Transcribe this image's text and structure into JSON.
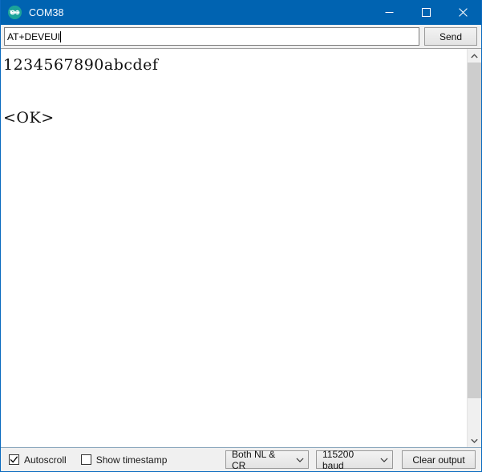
{
  "window": {
    "title": "COM38",
    "app_icon": "arduino-logo-icon",
    "controls": {
      "minimize": "minimize-icon",
      "maximize": "maximize-icon",
      "close": "close-icon"
    },
    "titlebar_color": "#0063b1",
    "border_color": "#0a6abf"
  },
  "command": {
    "input_value": "AT+DEVEUI",
    "input_placeholder": "",
    "send_label": "Send"
  },
  "output": {
    "lines": [
      "1234567890abcdef",
      "",
      "<OK>"
    ]
  },
  "scrollbar": {
    "up_arrow_icon": "chevron-up-icon",
    "down_arrow_icon": "chevron-down-icon",
    "thumb_position": "top"
  },
  "status": {
    "autoscroll": {
      "label": "Autoscroll",
      "checked": true
    },
    "show_timestamp": {
      "label": "Show timestamp",
      "checked": false
    },
    "line_ending": {
      "selected": "Both NL & CR",
      "chevron_icon": "chevron-down-icon"
    },
    "baud_rate": {
      "selected": "115200 baud",
      "chevron_icon": "chevron-down-icon"
    },
    "clear_label": "Clear output"
  }
}
